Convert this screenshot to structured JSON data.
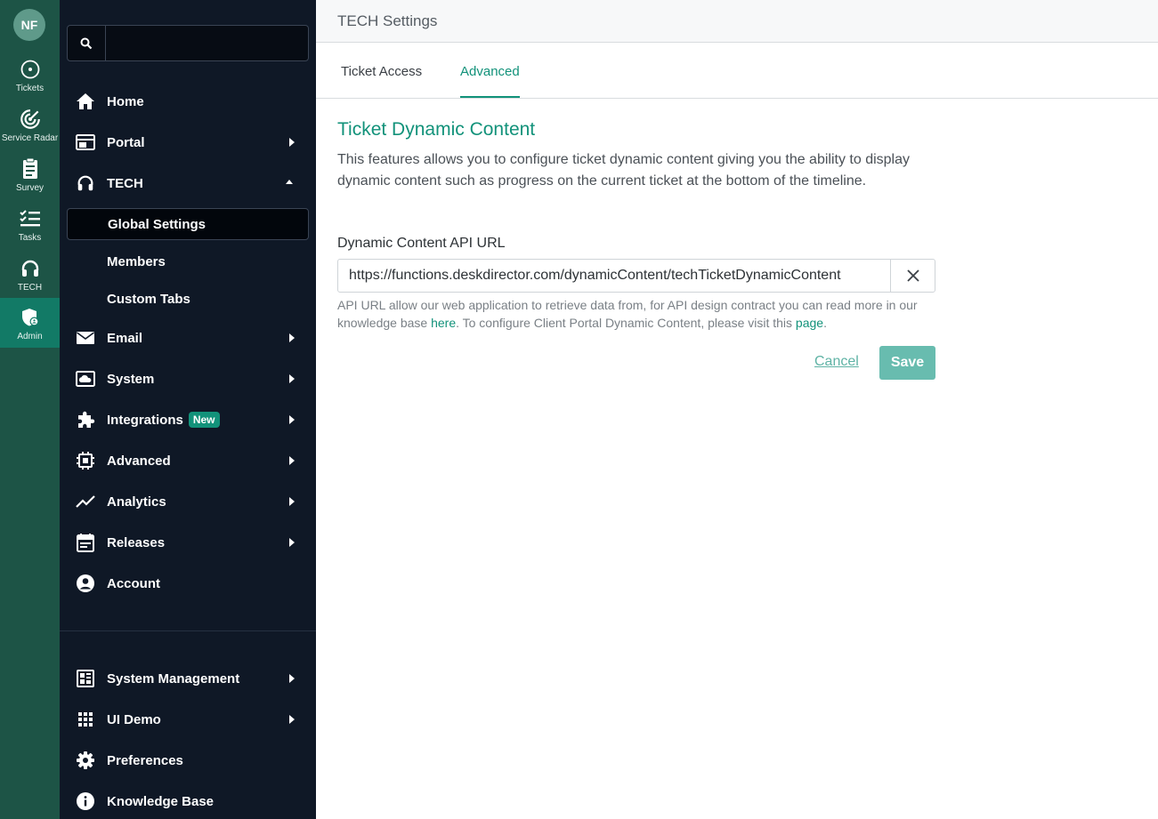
{
  "user": {
    "initials": "NF"
  },
  "rail": [
    {
      "label": "Tickets",
      "icon": "tickets-icon"
    },
    {
      "label": "Service Radar",
      "icon": "radar-icon"
    },
    {
      "label": "Survey",
      "icon": "survey-icon"
    },
    {
      "label": "Tasks",
      "icon": "tasks-icon"
    },
    {
      "label": "TECH",
      "icon": "headset-icon"
    },
    {
      "label": "Admin",
      "icon": "admin-shield-icon",
      "active": true
    }
  ],
  "search": {
    "placeholder": ""
  },
  "nav": {
    "home": "Home",
    "portal": "Portal",
    "tech": "TECH",
    "tech_sub": [
      "Global Settings",
      "Members",
      "Custom Tabs"
    ],
    "email": "Email",
    "system": "System",
    "integrations": "Integrations",
    "integrations_badge": "New",
    "advanced": "Advanced",
    "analytics": "Analytics",
    "releases": "Releases",
    "account": "Account",
    "system_management": "System Management",
    "ui_demo": "UI Demo",
    "preferences": "Preferences",
    "knowledge_base": "Knowledge Base"
  },
  "header": {
    "title": "TECH Settings"
  },
  "tabs": [
    "Ticket Access",
    "Advanced"
  ],
  "active_tab": "Advanced",
  "section": {
    "title": "Ticket Dynamic Content",
    "description": "This features allows you to configure ticket dynamic content giving you the ability to display dynamic content such as progress on the current ticket at the bottom of the timeline.",
    "field_label": "Dynamic Content API URL",
    "field_value": "https://functions.deskdirector.com/dynamicContent/techTicketDynamicContent",
    "help_part1": "API URL allow our web application to retrieve data from, for API design contract you can read more in our knowledge base ",
    "help_link1": "here",
    "help_part2": ". To configure Client Portal Dynamic Content, please visit this ",
    "help_link2": "page",
    "help_part3": "."
  },
  "actions": {
    "cancel": "Cancel",
    "save": "Save"
  },
  "colors": {
    "accent": "#12927a",
    "rail": "#1d5446",
    "sidebar": "#0f1826"
  }
}
